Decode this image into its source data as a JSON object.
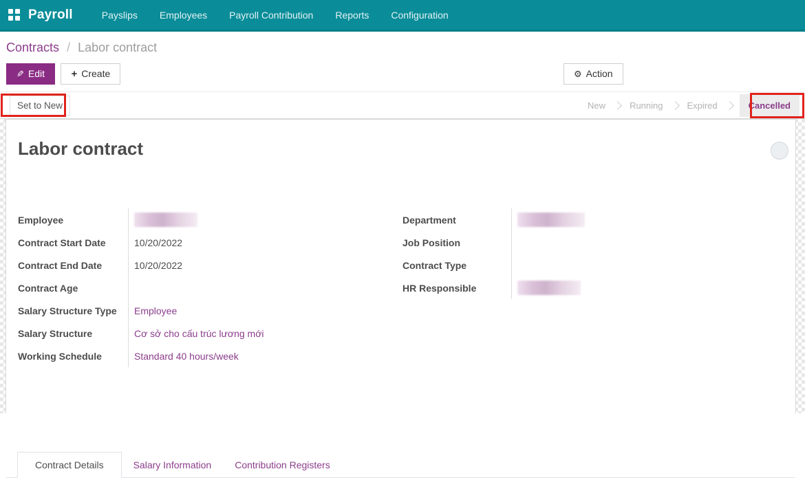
{
  "nav": {
    "app_name": "Payroll",
    "items": [
      "Payslips",
      "Employees",
      "Payroll Contribution",
      "Reports",
      "Configuration"
    ]
  },
  "breadcrumb": {
    "parent": "Contracts",
    "separator": "/",
    "current": "Labor contract"
  },
  "toolbar": {
    "edit_label": "Edit",
    "create_label": "Create",
    "action_label": "Action",
    "edit_icon": "pencil-icon",
    "create_icon": "plus-icon",
    "action_icon": "gear-icon",
    "gear_glyph": "⚙",
    "plus_glyph": "+",
    "pencil_glyph": "✎"
  },
  "statusbar": {
    "set_to_new_label": "Set to New",
    "stages": [
      {
        "label": "New",
        "active": false
      },
      {
        "label": "Running",
        "active": false
      },
      {
        "label": "Expired",
        "active": false
      },
      {
        "label": "Cancelled",
        "active": true
      }
    ],
    "annotations": [
      "set-to-new-highlight",
      "cancelled-highlight"
    ]
  },
  "form": {
    "title": "Labor contract",
    "left_fields": [
      {
        "label": "Employee",
        "value": "",
        "redacted": true
      },
      {
        "label": "Contract Start Date",
        "value": "10/20/2022",
        "redacted": false
      },
      {
        "label": "Contract End Date",
        "value": "10/20/2022",
        "redacted": false
      },
      {
        "label": "Contract Age",
        "value": "",
        "redacted": false
      },
      {
        "label": "Salary Structure Type",
        "value": "Employee",
        "link": true
      },
      {
        "label": "Salary Structure",
        "value": "Cơ sở cho cấu trúc lương mới",
        "link": true
      },
      {
        "label": "Working Schedule",
        "value": "Standard 40 hours/week",
        "link": true
      }
    ],
    "right_fields": [
      {
        "label": "Department",
        "value": "",
        "redacted": true
      },
      {
        "label": "Job Position",
        "value": "",
        "redacted": false
      },
      {
        "label": "Contract Type",
        "value": "",
        "redacted": false
      },
      {
        "label": "HR Responsible",
        "value": "",
        "redacted": true
      }
    ],
    "tabs": [
      {
        "label": "Contract Details",
        "active": true
      },
      {
        "label": "Salary Information",
        "active": false
      },
      {
        "label": "Contribution Registers",
        "active": false
      }
    ]
  },
  "colors": {
    "navbar_bg": "#0a8d99",
    "navbar_border": "#077e89",
    "accent_purple": "#8b3d8b",
    "primary_button_bg": "#8a2b84",
    "annotation_red": "#e0231c",
    "stage_active_bg": "#ececec",
    "label_text": "#4c4c4c",
    "muted_text": "#b3b3b3"
  }
}
